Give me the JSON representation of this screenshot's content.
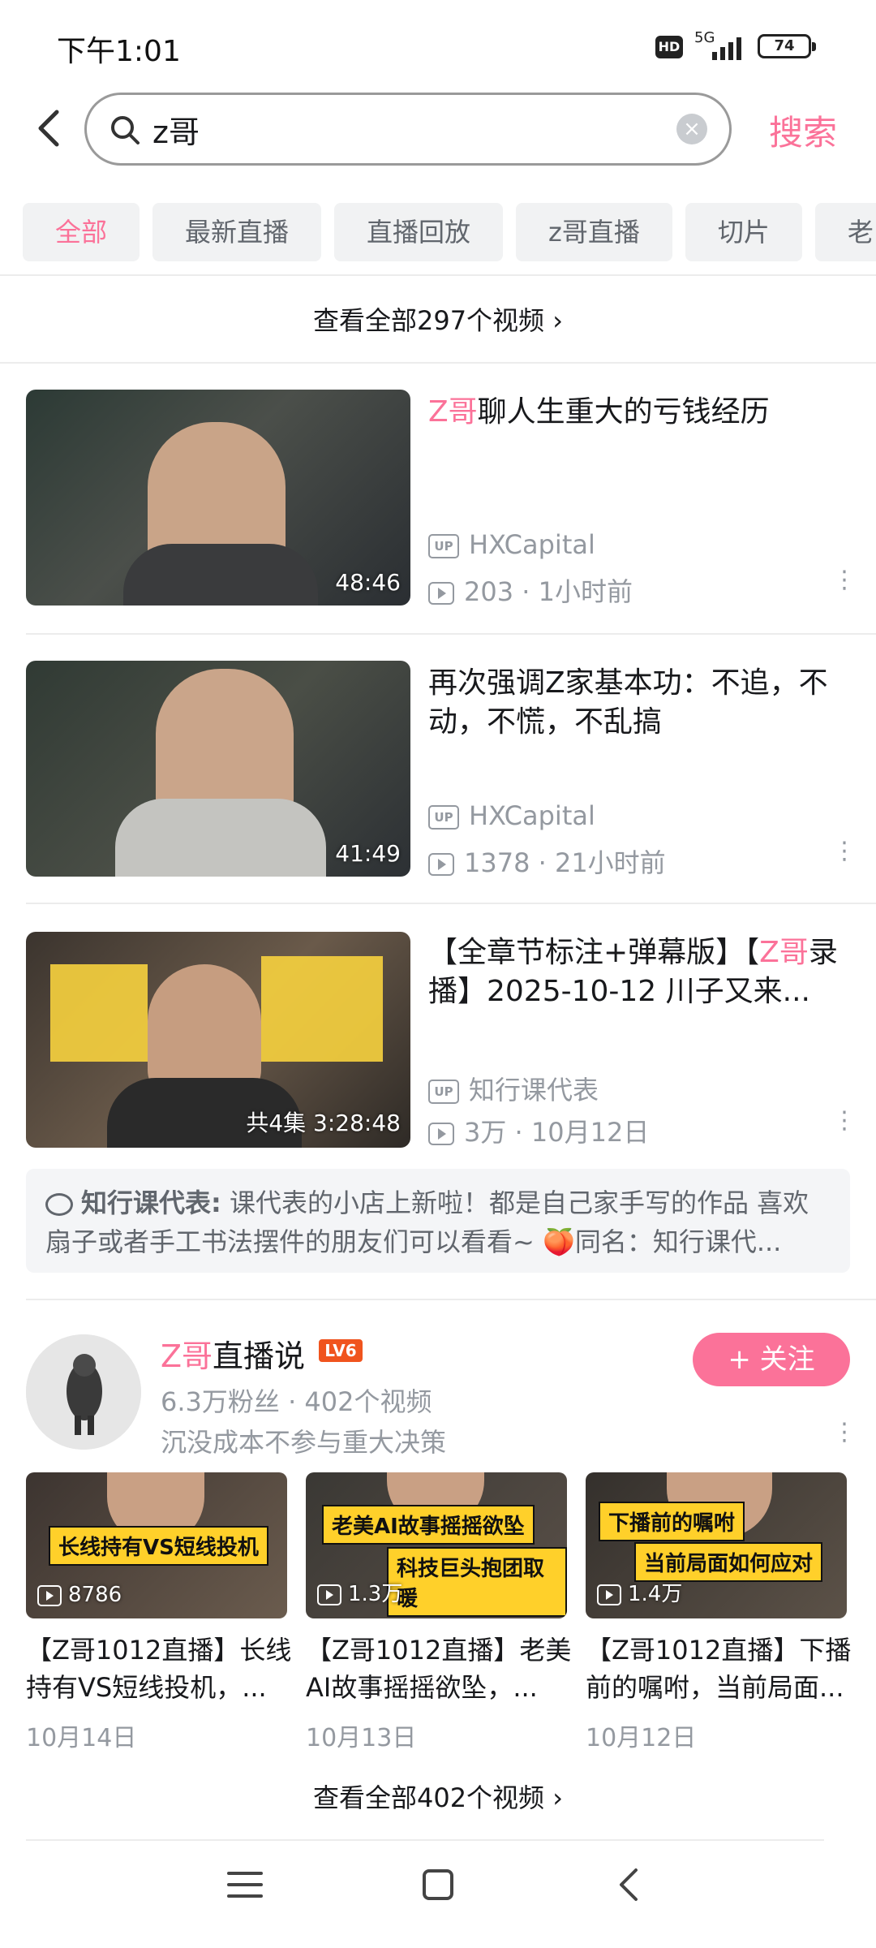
{
  "status_bar": {
    "time": "下午1:01",
    "hd": "HD",
    "network": "5G",
    "battery": "74"
  },
  "search": {
    "query": "z哥",
    "submit_label": "搜索"
  },
  "tabs": [
    "全部",
    "最新直播",
    "直播回放",
    "z哥直播",
    "切片",
    "老"
  ],
  "view_all_top": "查看全部297个视频",
  "videos": [
    {
      "title_highlight": "Z哥",
      "title_rest": "聊人生重大的亏钱经历",
      "duration": "48:46",
      "uploader": "HXCapital",
      "views": "203",
      "time": "1小时前"
    },
    {
      "title_prefix": "",
      "title_rest": "再次强调Z家基本功：不追，不动，不慌，不乱搞",
      "duration": "41:49",
      "uploader": "HXCapital",
      "views": "1378",
      "time": "21小时前"
    },
    {
      "title_prefix": "【全章节标注+弹幕版】【",
      "title_highlight": "Z哥",
      "title_rest": "录播】2025-10-12 川子又来...",
      "duration": "共4集 3:28:48",
      "uploader": "知行课代表",
      "views": "3万",
      "time": "10月12日"
    }
  ],
  "comment": {
    "author": "知行课代表:",
    "text": " 课代表的小店上新啦！都是自己家手写的作品 喜欢扇子或者手工书法摆件的朋友们可以看看~ 🍑同名：知行课代..."
  },
  "channel": {
    "name_highlight": "Z哥",
    "name_rest": "直播说",
    "level": "LV6",
    "fans": "6.3万粉丝",
    "video_count": "402个视频",
    "description": "沉没成本不参与重大决策",
    "follow_label": "+ 关注",
    "videos": [
      {
        "title": "【Z哥1012直播】长线持有VS短线投机，...",
        "views": "8786",
        "date": "10月14日",
        "caption": "长线持有VS短线投机"
      },
      {
        "title": "【Z哥1012直播】老美AI故事摇摇欲坠，...",
        "views": "1.3万",
        "date": "10月13日",
        "caption": "老美AI故事摇摇欲坠",
        "caption2": "科技巨头抱团取暖"
      },
      {
        "title": "【Z哥1012直播】下播前的嘱咐，当前局面...",
        "views": "1.4万",
        "date": "10月12日",
        "caption": "下播前的嘱咐",
        "caption2": "当前局面如何应对"
      }
    ],
    "view_all": "查看全部402个视频"
  },
  "colors": {
    "accent": "#fb7299",
    "text": "#18191c",
    "secondary": "#9499a0"
  }
}
